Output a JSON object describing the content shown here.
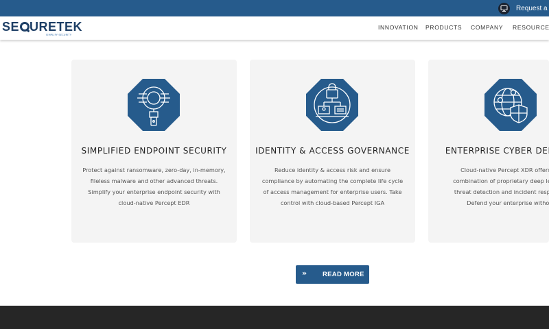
{
  "topbar": {
    "demo_label": "Request a Demo",
    "demo_icon": "screen-icon"
  },
  "header": {
    "logo_text_before": "SE",
    "logo_text_after": "URETEK",
    "logo_tagline": "SIMPLIFY SECURITY",
    "nav": [
      "INNOVATION",
      "PRODUCTS",
      "COMPANY",
      "RESOURCES"
    ]
  },
  "cards": [
    {
      "icon": "endpoint-scan-icon",
      "title": "SIMPLIFIED ENDPOINT SECURITY",
      "lines": [
        "Protect against ransomware, zero-day, in-memory,",
        "fileless malware and other advanced threats.",
        "Simplify your enterprise endpoint security with",
        "cloud-native Percept EDR"
      ]
    },
    {
      "icon": "identity-lock-icon",
      "title": "IDENTITY & ACCESS GOVERNANCE",
      "lines": [
        "Reduce identity & access risk and ensure",
        "compliance by automating the complete life cycle",
        "of access management for enterprise users. Take",
        "control with cloud-based Percept IGA"
      ]
    },
    {
      "icon": "globe-shield-icon",
      "title": "ENTERPRISE CYBER DEFENSE",
      "lines": [
        "Cloud-native Percept XDR offers a u",
        "combination of proprietary deep learning",
        "threat detection and incident response t",
        "Defend your enterprise without"
      ]
    }
  ],
  "read_more": {
    "label": "READ MORE",
    "icon": "double-chevron-icon"
  },
  "colors": {
    "brand_blue": "#265b8c",
    "card_bg": "#f4f4f4",
    "footer": "#262626"
  }
}
